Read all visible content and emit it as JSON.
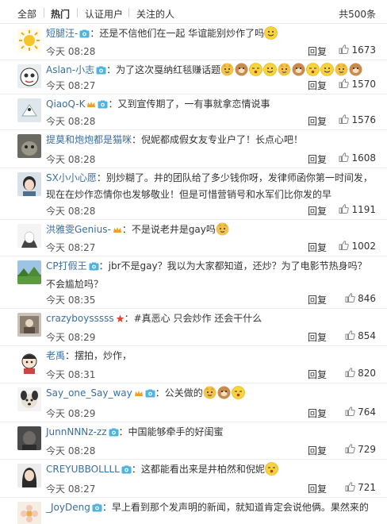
{
  "tabs": [
    "全部",
    "热门",
    "认证用户",
    "关注的人"
  ],
  "total_count": "共500条",
  "reply_label": "回复",
  "comments": [
    {
      "user": "短腿汪-",
      "text": "：还是不信他们在一起 华谊能别炒作了吗",
      "time": "今天 08:28",
      "likes": "1673"
    },
    {
      "user": "Aslan-小志",
      "text": "：为了这次戛纳红毯赚话题",
      "time": "今天 08:27",
      "likes": "1570"
    },
    {
      "user": "QiaoQ-K",
      "text": "：又到宣传期了，一有事就拿恋情说事",
      "time": "今天 08:28",
      "likes": "1576"
    },
    {
      "user": "提莫和炮炮都是猫咪",
      "text": "：倪妮都成假女友专业户了！长点心吧！",
      "time": "今天 08:28",
      "likes": "1608"
    },
    {
      "user": "SX小小心愿",
      "text": "：别炒糊了。井的团队给了多少钱你呀，发律师函你第一时间发，现在在炒作恋情你也发够敬业！但是可惜营销号和水军们比你发的早",
      "time": "今天 08:28",
      "likes": "1191"
    },
    {
      "user": "洪雅雯Genius-",
      "text": "：不是说老井是gay吗",
      "time": "今天 08:27",
      "likes": "1002"
    },
    {
      "user": "CP打假王",
      "text": "：jbr不是gay？我以为大家都知道，还炒？为了电影节热身吗？不会尴尬吗？",
      "time": "今天 08:35",
      "likes": "846"
    },
    {
      "user": "crazyboysssss",
      "text": "：#真恶心 只会炒作 还会干什么",
      "time": "今天 08:29",
      "likes": "854"
    },
    {
      "user": "老禹",
      "text": "：摆拍，炒作，",
      "time": "今天 08:31",
      "likes": "820"
    },
    {
      "user": "Say_one_Say_way",
      "text": "：公关做的",
      "time": "今天 08:29",
      "likes": "764"
    },
    {
      "user": "JunnNNNz-zz",
      "text": "：中国能够牵手的好闺蜜",
      "time": "今天 08:28",
      "likes": "729"
    },
    {
      "user": "CREYUBBOLLLL",
      "text": "：这都能看出来是井柏然和倪妮",
      "time": "今天 08:27",
      "likes": "721"
    },
    {
      "user": "_JoyDeng",
      "text": "：早上看到那个发声明的新闻，就知道肯定会说他俩。果然来的",
      "time": "",
      "likes": ""
    }
  ],
  "icons": {
    "like": "thumbs-up-icon",
    "vip": "camera-verified-icon",
    "emoji": "face-emoji-icon"
  },
  "colors": {
    "username": "#3b6fa0",
    "text": "#333333",
    "divider": "#ececec"
  }
}
